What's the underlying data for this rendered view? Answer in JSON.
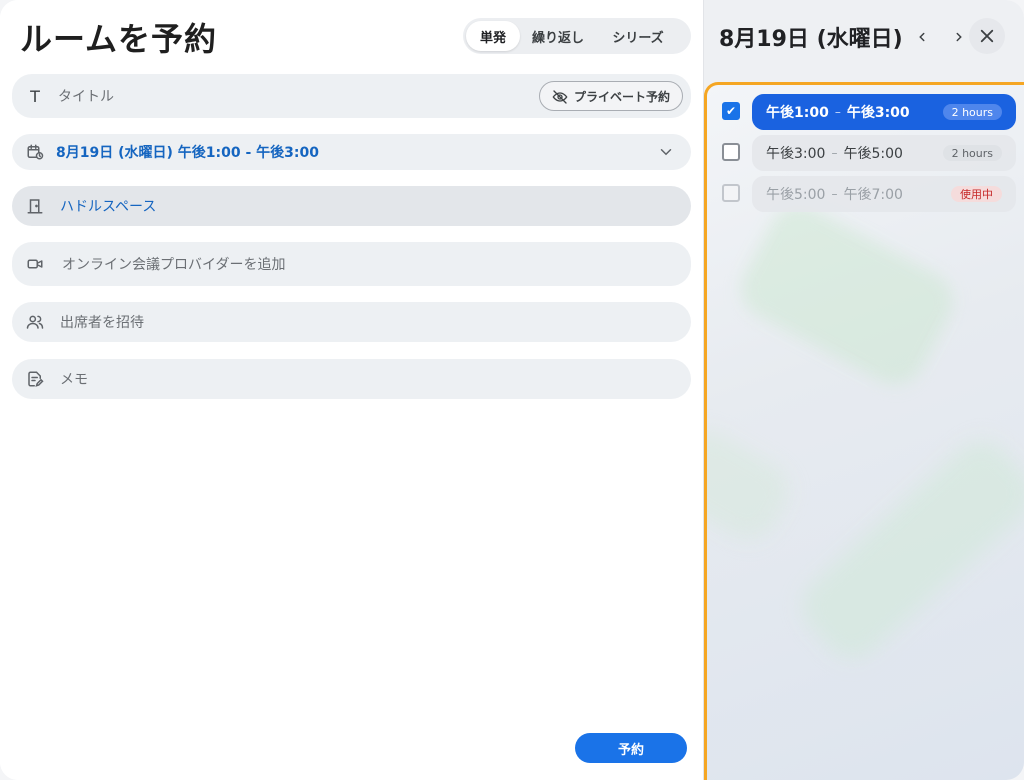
{
  "left": {
    "title": "ルームを予約",
    "segments": [
      "単発",
      "繰り返し",
      "シリーズ"
    ],
    "active_segment": "単発",
    "title_field": {
      "placeholder": "タイトル",
      "icon": "text-t-icon"
    },
    "private_button": {
      "label": "プライベート予約",
      "icon": "eye-off-icon"
    },
    "date_field": {
      "value": "8月19日 (水曜日) 午後1:00 - 午後3:00",
      "icon": "calendar-clock-icon"
    },
    "room_field": {
      "value": "ハドルスペース",
      "icon": "door-icon"
    },
    "online_field": {
      "placeholder": "オンライン会議プロバイダーを追加",
      "icon": "video-icon"
    },
    "people_field": {
      "placeholder": "出席者を招待",
      "icon": "people-icon"
    },
    "memo_field": {
      "placeholder": "メモ",
      "icon": "note-edit-icon"
    },
    "book_button": "予約"
  },
  "right": {
    "date_title": "8月19日 (水曜日)",
    "slots": [
      {
        "start": "午後1:00",
        "end": "午後3:00",
        "badge": "2 hours",
        "checked": true,
        "state": "selected"
      },
      {
        "start": "午後3:00",
        "end": "午後5:00",
        "badge": "2 hours",
        "checked": false,
        "state": "available"
      },
      {
        "start": "午後5:00",
        "end": "午後7:00",
        "badge": "使用中",
        "checked": false,
        "state": "in-use"
      }
    ]
  },
  "colors": {
    "accent": "#1a73e8",
    "selected_slot": "#1a62e0",
    "highlight_border": "#f5a623",
    "in_use": "#c62828"
  }
}
